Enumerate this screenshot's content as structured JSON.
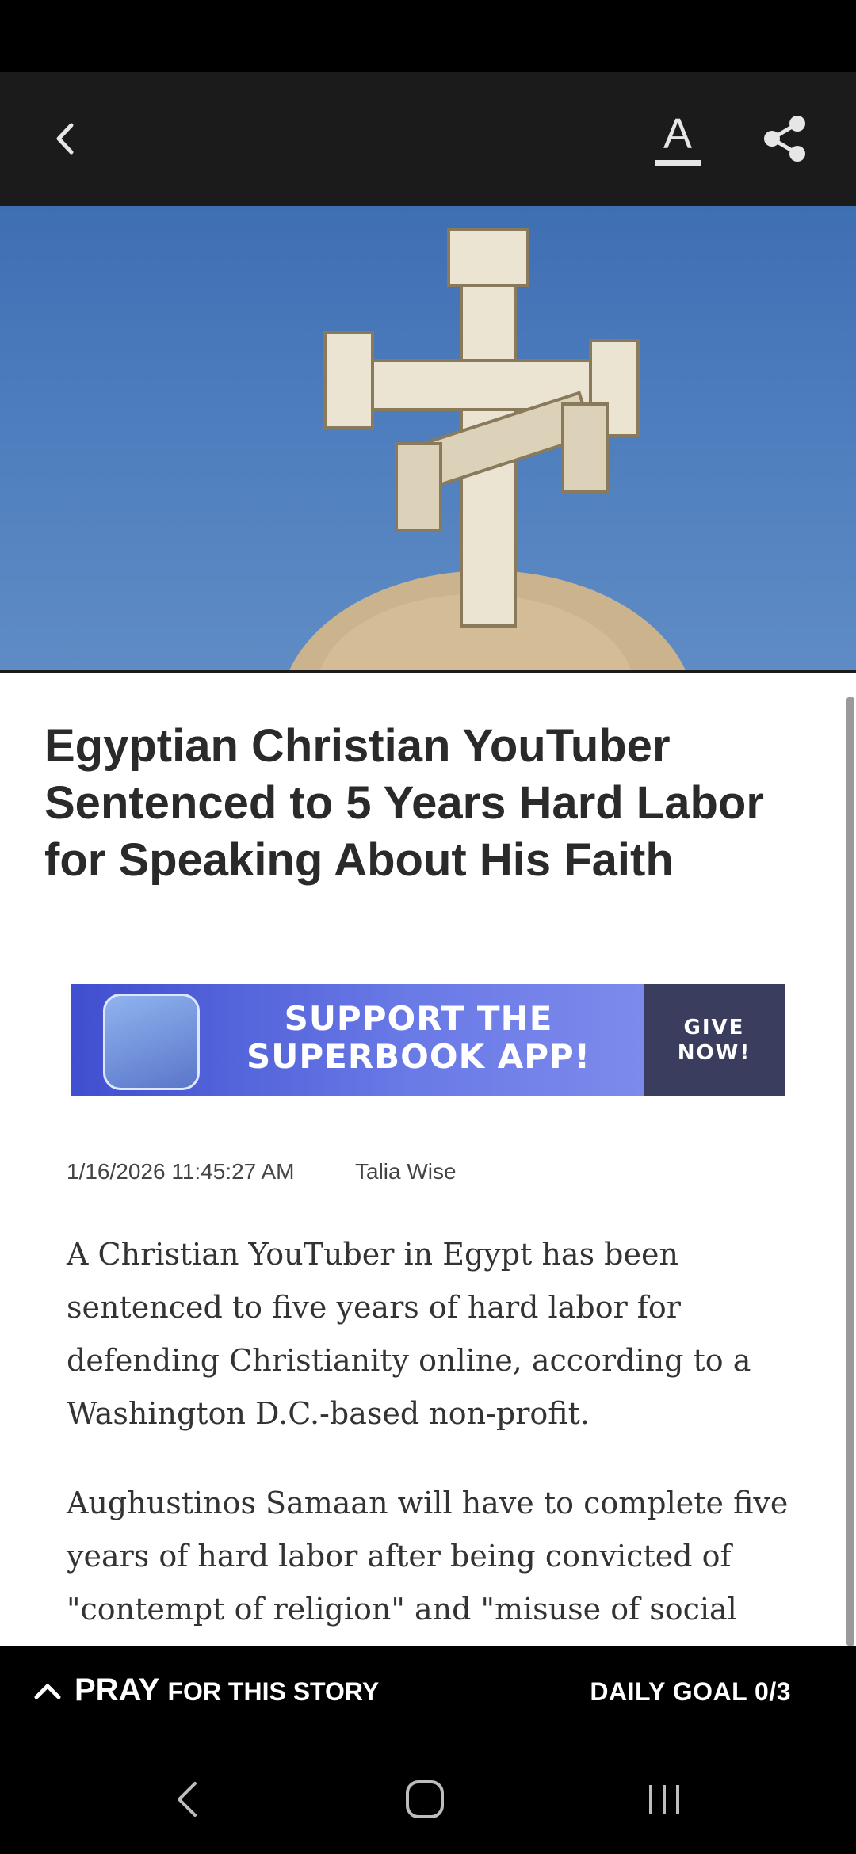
{
  "toolbar": {
    "back_icon": "chevron-left-icon",
    "font_icon": "text-size-icon",
    "font_label": "A",
    "share_icon": "share-icon"
  },
  "hero": {
    "image": "coptic-cross-on-dome-photo"
  },
  "article": {
    "headline": "Egyptian Christian YouTuber Sentenced to 5 Years Hard Labor for Speaking About His Faith",
    "promo": {
      "text": "SUPPORT THE SUPERBOOK APP!",
      "button": "GIVE NOW!"
    },
    "date": "1/16/2026 11:45:27 AM",
    "author": "Talia Wise",
    "paragraphs": [
      "A Christian YouTuber in Egypt has been sentenced to five years of hard labor for defending Christianity online, according to a Washington D.C.-based non-profit.",
      "Aughustinos Samaan will have to complete five years of hard labor after being convicted of \"contempt of religion\" and \"misuse of social"
    ]
  },
  "pray_bar": {
    "strong": "PRAY",
    "rest": "FOR THIS STORY",
    "goal": "DAILY GOAL 0/3"
  },
  "system_nav": {
    "back": "back-nav-icon",
    "home": "home-nav-icon",
    "recents": "recents-nav-icon"
  }
}
